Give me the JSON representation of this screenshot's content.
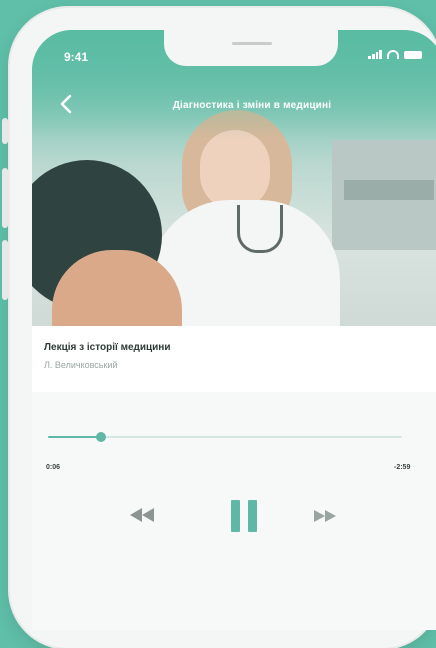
{
  "status": {
    "time": "9:41"
  },
  "header": {
    "title": "Діагностика і зміни в медицині"
  },
  "track": {
    "title": "Лекція з історії медицини",
    "author": "Л. Величковський"
  },
  "player": {
    "elapsed": "0:06",
    "remaining": "-2:59",
    "progress_fraction": 0.15,
    "state": "playing"
  },
  "colors": {
    "accent": "#5fb7a6",
    "background": "#5fbfa8"
  },
  "icons": {
    "back": "chevron-left-icon",
    "rewind": "rewind-icon",
    "pause": "pause-icon",
    "forward": "fast-forward-icon"
  }
}
